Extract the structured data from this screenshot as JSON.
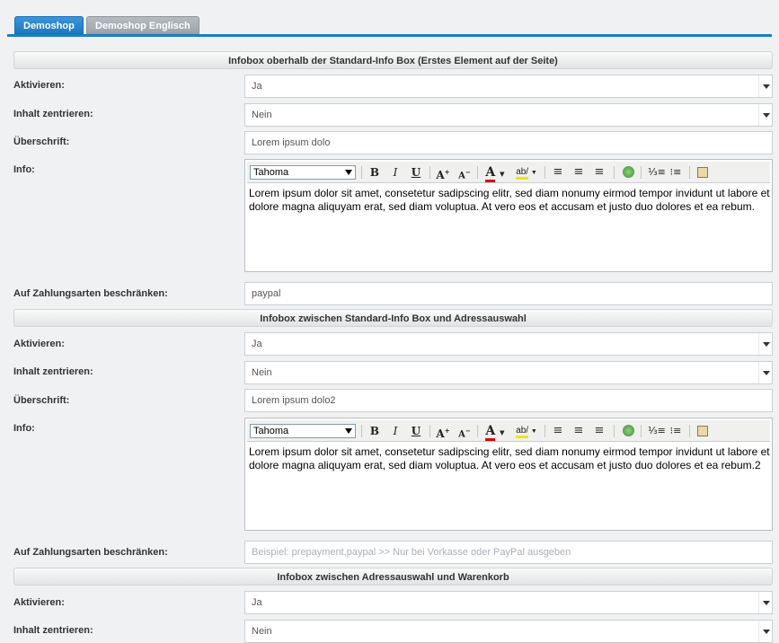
{
  "tabs": [
    {
      "label": "Demoshop"
    },
    {
      "label": "Demoshop Englisch"
    }
  ],
  "labels": {
    "activate": "Aktivieren:",
    "center": "Inhalt zentrieren:",
    "heading": "Überschrift:",
    "info": "Info:",
    "payment": "Auf Zahlungsarten beschränken:"
  },
  "editor_font": "Tahoma",
  "sections": [
    {
      "title": "Infobox oberhalb der Standard-Info Box (Erstes Element auf der Seite)",
      "activate": "Ja",
      "center": "Nein",
      "heading": "Lorem ipsum dolo",
      "info": "Lorem ipsum dolor sit amet, consetetur sadipscing elitr, sed diam nonumy eirmod tempor invidunt ut labore et dolore magna aliquyam erat, sed diam voluptua. At vero eos et accusam et justo duo dolores et ea rebum.",
      "payment": "paypal"
    },
    {
      "title": "Infobox zwischen Standard-Info Box und Adressauswahl",
      "activate": "Ja",
      "center": "Nein",
      "heading": "Lorem ipsum dolo2",
      "info": "Lorem ipsum dolor sit amet, consetetur sadipscing elitr, sed diam nonumy eirmod tempor invidunt ut labore et dolore magna aliquyam erat, sed diam voluptua. At vero eos et accusam et justo duo dolores et ea rebum.2",
      "payment_placeholder": "Beispiel: prepayment,paypal >> Nur bei Vorkasse oder PayPal ausgeben"
    },
    {
      "title": "Infobox zwischen Adressauswahl und Warenkorb",
      "activate": "Ja",
      "center": "Nein"
    }
  ]
}
